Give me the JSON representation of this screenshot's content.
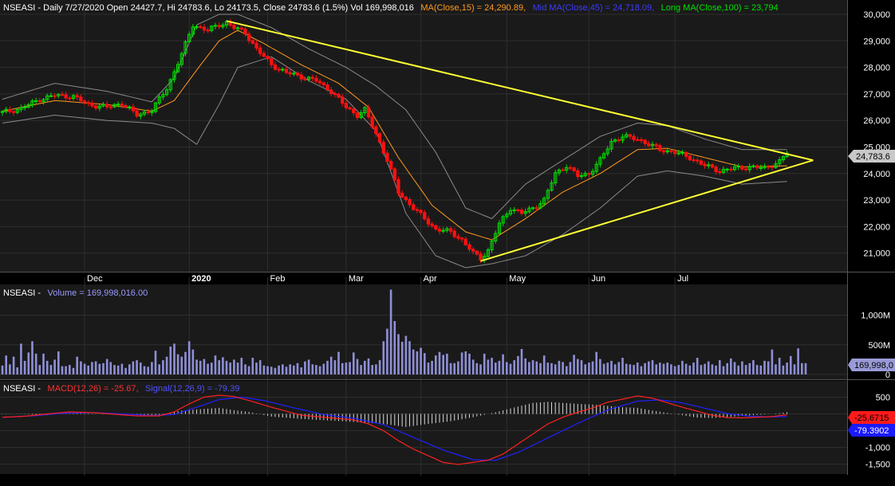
{
  "colors": {
    "background": "#000000",
    "panel_bg": "#1a1a1a",
    "grid": "#2e2e2e",
    "bull": "#00e000",
    "bear": "#ff1010",
    "ma_short": "#ff9a1f",
    "ma_long": "#c8c8c8",
    "bands": "#8a8a8a",
    "trendline": "#ffff33",
    "volume": "#8f8fd8",
    "macd": "#ff2020",
    "signal": "#2020ff",
    "hist": "#d8d8d8",
    "text": "#ffffff"
  },
  "price_panel": {
    "header_prefix": "NSEASI - Daily 7/27/2020 Open 24427.7, Hi 24783.6, Lo 24173.5, Close 24783.6 (1.5%) Vol 169,998,016",
    "ma15_label": "MA(Close,15) = 24,290.89,",
    "mid_ma_label": "Mid MA(Close,45) = 24,718.09,",
    "long_ma_label": "Long MA(Close,100) = 23,794",
    "last_price_badge": "24,783.6"
  },
  "volume_panel": {
    "header_prefix": "NSEASI -",
    "volume_label": "Volume = 169,998,016.00",
    "last_badge": "169,998,0"
  },
  "macd_panel": {
    "header_prefix": "NSEASI -",
    "macd_label": "MACD(12,26) = -25.67,",
    "signal_label": "Signal(12,26,9) = -79.39",
    "macd_badge": "-25.6715",
    "signal_badge": "-79.3902"
  },
  "chart_data": {
    "type": "line",
    "title": "NSEASI - Daily 7/27/2020",
    "x_labels": [
      "Dec",
      "2020",
      "Feb",
      "Mar",
      "Apr",
      "May",
      "Jun",
      "Jul"
    ],
    "price": {
      "y_ticks": [
        21000,
        22000,
        23000,
        24000,
        25000,
        26000,
        27000,
        28000,
        29000,
        30000
      ],
      "y_tick_labels": [
        "21,000",
        "22,000",
        "23,000",
        "24,000",
        "25,000",
        "26,000",
        "27,000",
        "28,000",
        "29,000",
        "30,000"
      ],
      "ylim": [
        20450,
        30000
      ],
      "close_keypoints": [
        [
          0,
          26300
        ],
        [
          5,
          26450
        ],
        [
          10,
          26800
        ],
        [
          14,
          26950
        ],
        [
          19,
          26900
        ],
        [
          23,
          26600
        ],
        [
          28,
          26500
        ],
        [
          32,
          26650
        ],
        [
          36,
          26200
        ],
        [
          40,
          26400
        ],
        [
          44,
          27200
        ],
        [
          48,
          28500
        ],
        [
          51,
          29600
        ],
        [
          55,
          29400
        ],
        [
          58,
          29600
        ],
        [
          60,
          29700
        ],
        [
          62,
          29500
        ],
        [
          65,
          29300
        ],
        [
          68,
          28700
        ],
        [
          72,
          28100
        ],
        [
          76,
          27800
        ],
        [
          80,
          27650
        ],
        [
          84,
          27500
        ],
        [
          88,
          27100
        ],
        [
          92,
          26500
        ],
        [
          95,
          26200
        ],
        [
          97,
          26400
        ],
        [
          100,
          25500
        ],
        [
          103,
          24500
        ],
        [
          106,
          23300
        ],
        [
          110,
          22700
        ],
        [
          113,
          22300
        ],
        [
          116,
          21900
        ],
        [
          120,
          21800
        ],
        [
          123,
          21500
        ],
        [
          126,
          21000
        ],
        [
          128,
          20800
        ],
        [
          130,
          21100
        ],
        [
          133,
          22100
        ],
        [
          136,
          22700
        ],
        [
          139,
          22500
        ],
        [
          142,
          22700
        ],
        [
          145,
          23000
        ],
        [
          148,
          24000
        ],
        [
          151,
          24300
        ],
        [
          154,
          23900
        ],
        [
          157,
          24000
        ],
        [
          160,
          24500
        ],
        [
          163,
          25200
        ],
        [
          166,
          25400
        ],
        [
          170,
          25300
        ],
        [
          173,
          25100
        ],
        [
          176,
          24900
        ],
        [
          180,
          24800
        ],
        [
          184,
          24600
        ],
        [
          188,
          24300
        ],
        [
          192,
          24100
        ],
        [
          196,
          24200
        ],
        [
          200,
          24250
        ],
        [
          204,
          24200
        ],
        [
          208,
          24450
        ],
        [
          210,
          24784
        ]
      ],
      "ma15_keypoints": [
        [
          0,
          26350
        ],
        [
          14,
          26750
        ],
        [
          28,
          26600
        ],
        [
          40,
          26350
        ],
        [
          46,
          26750
        ],
        [
          52,
          27900
        ],
        [
          58,
          29000
        ],
        [
          63,
          29400
        ],
        [
          70,
          28900
        ],
        [
          80,
          28100
        ],
        [
          90,
          27400
        ],
        [
          98,
          26500
        ],
        [
          106,
          24600
        ],
        [
          115,
          22800
        ],
        [
          124,
          21800
        ],
        [
          131,
          21500
        ],
        [
          140,
          22300
        ],
        [
          150,
          23300
        ],
        [
          160,
          24000
        ],
        [
          170,
          24900
        ],
        [
          178,
          24950
        ],
        [
          188,
          24600
        ],
        [
          198,
          24250
        ],
        [
          210,
          24290
        ]
      ],
      "bands_upper_keypoints": [
        [
          0,
          26800
        ],
        [
          14,
          27400
        ],
        [
          28,
          27100
        ],
        [
          40,
          26700
        ],
        [
          46,
          27600
        ],
        [
          52,
          29600
        ],
        [
          58,
          30000
        ],
        [
          63,
          30000
        ],
        [
          72,
          29500
        ],
        [
          82,
          28700
        ],
        [
          92,
          28000
        ],
        [
          100,
          27300
        ],
        [
          108,
          26400
        ],
        [
          116,
          24800
        ],
        [
          124,
          22700
        ],
        [
          131,
          22300
        ],
        [
          140,
          23600
        ],
        [
          150,
          24500
        ],
        [
          160,
          25400
        ],
        [
          170,
          25900
        ],
        [
          178,
          25800
        ],
        [
          188,
          25300
        ],
        [
          198,
          24900
        ],
        [
          210,
          24900
        ]
      ],
      "bands_lower_keypoints": [
        [
          0,
          25900
        ],
        [
          14,
          26200
        ],
        [
          28,
          26000
        ],
        [
          40,
          25900
        ],
        [
          46,
          25700
        ],
        [
          52,
          25100
        ],
        [
          58,
          26600
        ],
        [
          63,
          28000
        ],
        [
          72,
          28400
        ],
        [
          82,
          27500
        ],
        [
          92,
          26800
        ],
        [
          100,
          25600
        ],
        [
          108,
          22500
        ],
        [
          116,
          20900
        ],
        [
          124,
          20450
        ],
        [
          131,
          20600
        ],
        [
          140,
          20900
        ],
        [
          150,
          21700
        ],
        [
          160,
          22700
        ],
        [
          170,
          23900
        ],
        [
          178,
          24100
        ],
        [
          188,
          23900
        ],
        [
          198,
          23600
        ],
        [
          210,
          23700
        ]
      ],
      "trendlines": [
        {
          "from": [
            60,
            29750
          ],
          "to": [
            217,
            24500
          ]
        },
        {
          "from": [
            128,
            20700
          ],
          "to": [
            217,
            24500
          ]
        }
      ]
    },
    "volume": {
      "y_ticks": [
        0,
        500,
        1000
      ],
      "y_tick_labels": [
        "0",
        "500M",
        "1,000M"
      ],
      "ylim": [
        0,
        1450
      ],
      "values_m": [
        150,
        320,
        170,
        300,
        120,
        520,
        230,
        370,
        560,
        350,
        160,
        350,
        230,
        160,
        250,
        390,
        140,
        140,
        160,
        110,
        300,
        220,
        180,
        150,
        210,
        220,
        180,
        190,
        260,
        210,
        160,
        150,
        180,
        110,
        170,
        220,
        240,
        200,
        140,
        130,
        210,
        400,
        170,
        240,
        300,
        470,
        520,
        340,
        300,
        380,
        560,
        420,
        250,
        230,
        260,
        180,
        200,
        320,
        240,
        290,
        230,
        200,
        250,
        200,
        280,
        170,
        140,
        280,
        200,
        240,
        150,
        140,
        130,
        110,
        150,
        170,
        130,
        170,
        150,
        190,
        120,
        220,
        250,
        170,
        160,
        140,
        180,
        230,
        300,
        240,
        380,
        190,
        200,
        210,
        370,
        260,
        160,
        230,
        270,
        160,
        170,
        240,
        560,
        770,
        1430,
        900,
        680,
        550,
        650,
        560,
        420,
        390,
        450,
        360,
        200,
        230,
        320,
        380,
        330,
        350,
        190,
        190,
        220,
        370,
        390,
        350,
        250,
        190,
        170,
        350,
        250,
        280,
        200,
        230,
        340,
        210,
        180,
        240,
        310,
        430,
        270,
        210,
        240,
        220,
        190,
        320,
        200,
        190,
        170,
        230,
        210,
        140,
        210,
        330,
        260,
        240,
        170,
        200,
        220,
        380,
        260,
        180,
        200,
        230,
        170,
        210,
        280,
        180,
        170,
        160,
        200,
        140,
        190,
        220,
        240,
        170,
        200,
        180,
        200,
        170,
        140,
        160,
        230,
        180,
        150,
        200,
        280,
        160,
        180,
        220,
        170,
        150,
        240,
        140,
        190,
        270,
        210,
        150,
        220,
        160,
        190,
        240,
        160,
        150,
        230,
        220,
        420,
        170,
        280,
        150,
        200,
        310,
        170,
        440,
        190,
        190
      ]
    },
    "macd": {
      "y_ticks": [
        -1500,
        -1000,
        -500,
        0,
        500
      ],
      "y_tick_labels": [
        "-1,500",
        "-1,000",
        "-500",
        "0",
        "500"
      ],
      "ylim": [
        -1750,
        750
      ],
      "macd_keypoints": [
        [
          0,
          -100
        ],
        [
          6,
          -70
        ],
        [
          12,
          0
        ],
        [
          18,
          60
        ],
        [
          24,
          40
        ],
        [
          30,
          -10
        ],
        [
          36,
          -60
        ],
        [
          42,
          -60
        ],
        [
          46,
          60
        ],
        [
          50,
          300
        ],
        [
          54,
          500
        ],
        [
          58,
          560
        ],
        [
          62,
          520
        ],
        [
          66,
          400
        ],
        [
          72,
          200
        ],
        [
          80,
          -40
        ],
        [
          88,
          -120
        ],
        [
          94,
          -180
        ],
        [
          98,
          -300
        ],
        [
          102,
          -500
        ],
        [
          106,
          -800
        ],
        [
          110,
          -1050
        ],
        [
          114,
          -1250
        ],
        [
          118,
          -1450
        ],
        [
          122,
          -1510
        ],
        [
          126,
          -1450
        ],
        [
          130,
          -1380
        ],
        [
          134,
          -1200
        ],
        [
          138,
          -900
        ],
        [
          142,
          -600
        ],
        [
          146,
          -300
        ],
        [
          150,
          -100
        ],
        [
          154,
          50
        ],
        [
          158,
          180
        ],
        [
          162,
          350
        ],
        [
          166,
          440
        ],
        [
          170,
          540
        ],
        [
          174,
          470
        ],
        [
          178,
          330
        ],
        [
          182,
          200
        ],
        [
          186,
          80
        ],
        [
          190,
          -40
        ],
        [
          194,
          -110
        ],
        [
          198,
          -120
        ],
        [
          202,
          -100
        ],
        [
          206,
          -80
        ],
        [
          210,
          -26
        ]
      ],
      "signal_keypoints": [
        [
          0,
          -100
        ],
        [
          8,
          -60
        ],
        [
          16,
          20
        ],
        [
          24,
          40
        ],
        [
          32,
          0
        ],
        [
          40,
          -50
        ],
        [
          46,
          -20
        ],
        [
          52,
          200
        ],
        [
          58,
          430
        ],
        [
          64,
          500
        ],
        [
          70,
          400
        ],
        [
          78,
          180
        ],
        [
          86,
          -20
        ],
        [
          94,
          -130
        ],
        [
          102,
          -320
        ],
        [
          110,
          -700
        ],
        [
          118,
          -1080
        ],
        [
          126,
          -1370
        ],
        [
          132,
          -1390
        ],
        [
          138,
          -1150
        ],
        [
          146,
          -720
        ],
        [
          154,
          -280
        ],
        [
          162,
          120
        ],
        [
          170,
          380
        ],
        [
          176,
          420
        ],
        [
          182,
          330
        ],
        [
          188,
          170
        ],
        [
          194,
          10
        ],
        [
          200,
          -70
        ],
        [
          206,
          -90
        ],
        [
          210,
          -79
        ]
      ],
      "hist_keypoints": [
        [
          0,
          10
        ],
        [
          6,
          -10
        ],
        [
          12,
          -40
        ],
        [
          18,
          40
        ],
        [
          24,
          10
        ],
        [
          30,
          -20
        ],
        [
          36,
          -20
        ],
        [
          42,
          -40
        ],
        [
          48,
          100
        ],
        [
          54,
          150
        ],
        [
          58,
          180
        ],
        [
          62,
          110
        ],
        [
          66,
          60
        ],
        [
          72,
          -80
        ],
        [
          80,
          -150
        ],
        [
          88,
          -200
        ],
        [
          94,
          -240
        ],
        [
          102,
          -300
        ],
        [
          108,
          -390
        ],
        [
          114,
          -300
        ],
        [
          120,
          -220
        ],
        [
          126,
          -100
        ],
        [
          132,
          50
        ],
        [
          138,
          220
        ],
        [
          142,
          330
        ],
        [
          146,
          360
        ],
        [
          150,
          330
        ],
        [
          154,
          300
        ],
        [
          158,
          280
        ],
        [
          162,
          240
        ],
        [
          166,
          200
        ],
        [
          170,
          180
        ],
        [
          174,
          100
        ],
        [
          178,
          30
        ],
        [
          182,
          -40
        ],
        [
          186,
          -110
        ],
        [
          190,
          -120
        ],
        [
          194,
          -100
        ],
        [
          198,
          -60
        ],
        [
          202,
          -30
        ],
        [
          206,
          0
        ],
        [
          210,
          50
        ]
      ]
    }
  }
}
